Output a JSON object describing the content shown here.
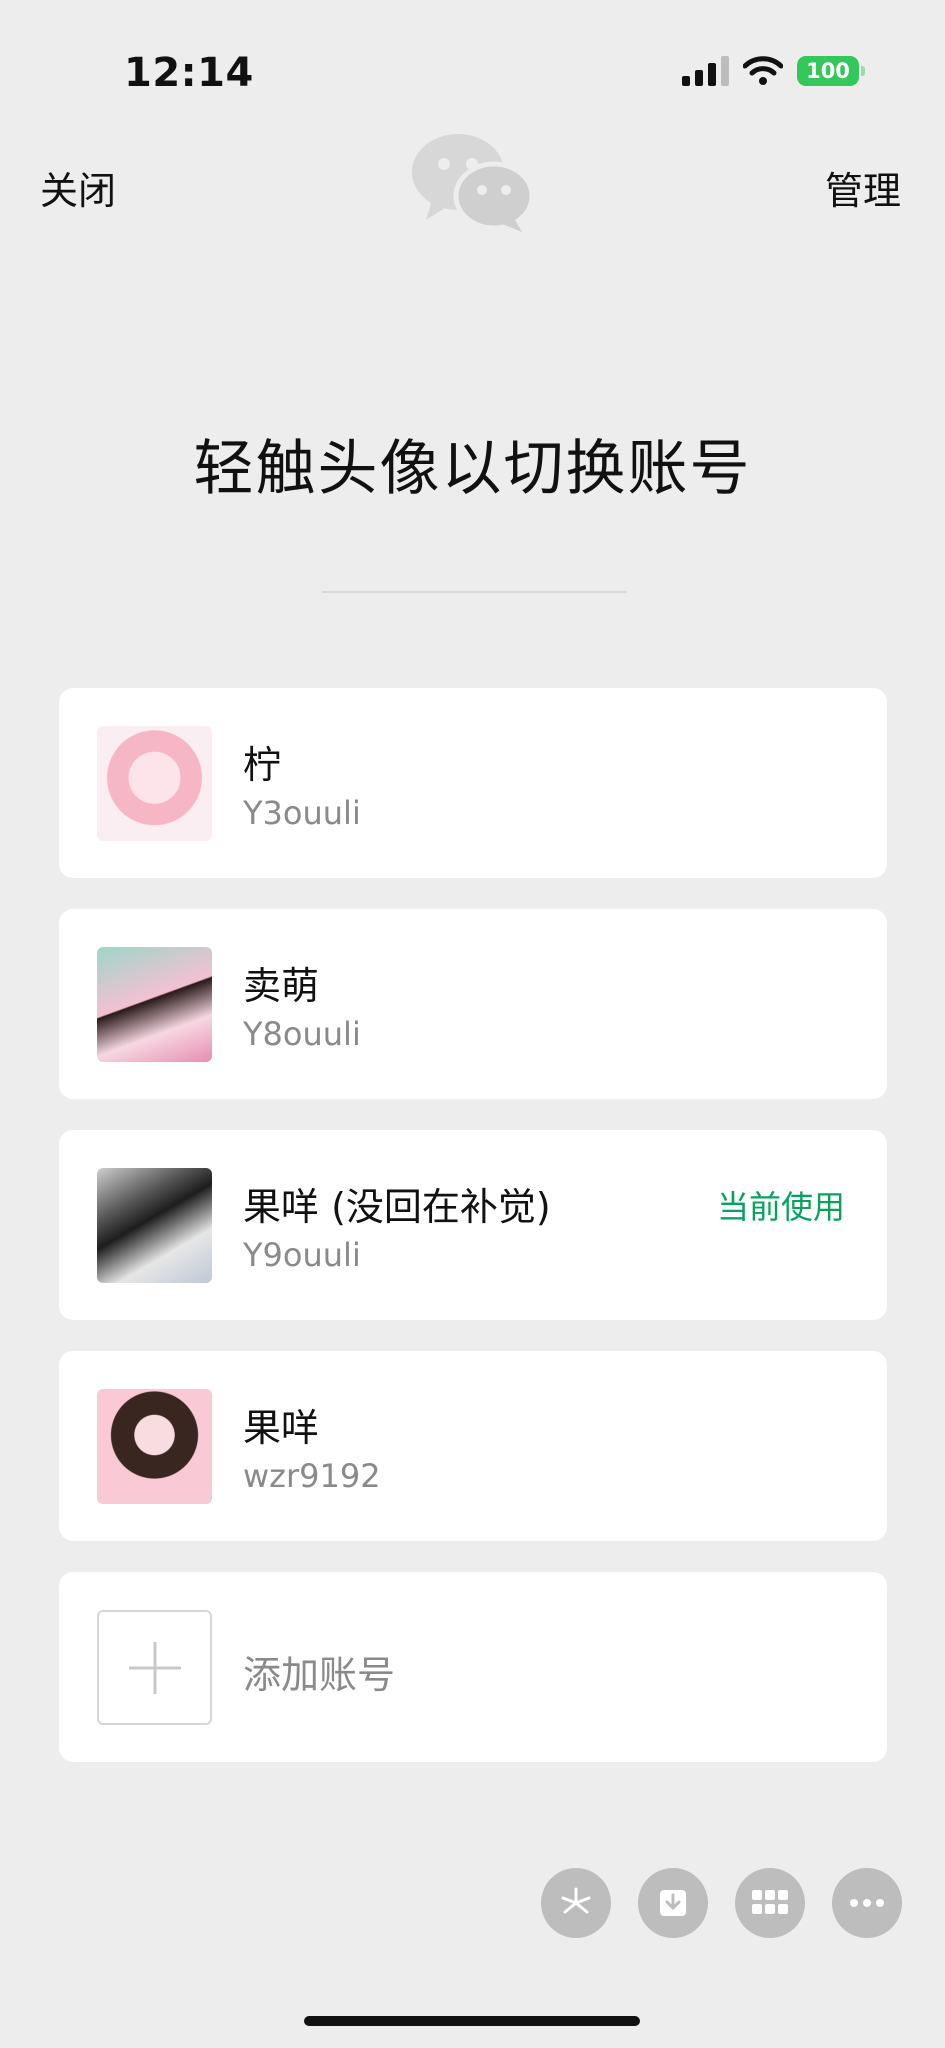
{
  "status": {
    "time": "12:14",
    "battery": "100",
    "icons": [
      "signal-icon",
      "wifi-icon",
      "battery-icon"
    ]
  },
  "nav": {
    "close_label": "关闭",
    "manage_label": "管理",
    "logo_icon": "wechat-logo-icon"
  },
  "headline": "轻触头像以切换账号",
  "accounts": [
    {
      "name": "柠",
      "wxid": "Y3ouuli",
      "badge": ""
    },
    {
      "name": "卖萌",
      "wxid": "Y8ouuli",
      "badge": ""
    },
    {
      "name": "果咩 (没回在补觉)",
      "wxid": "Y9ouuli",
      "badge": "当前使用"
    },
    {
      "name": "果咩",
      "wxid": "wzr9192",
      "badge": ""
    }
  ],
  "add_account_label": "添加账号",
  "floating_buttons": [
    "pinwheel-icon",
    "download-icon",
    "grid-icon",
    "more-icon"
  ],
  "colors": {
    "background": "#ededed",
    "card": "#ffffff",
    "accent_green": "#07a35e",
    "battery_green": "#34c759"
  }
}
